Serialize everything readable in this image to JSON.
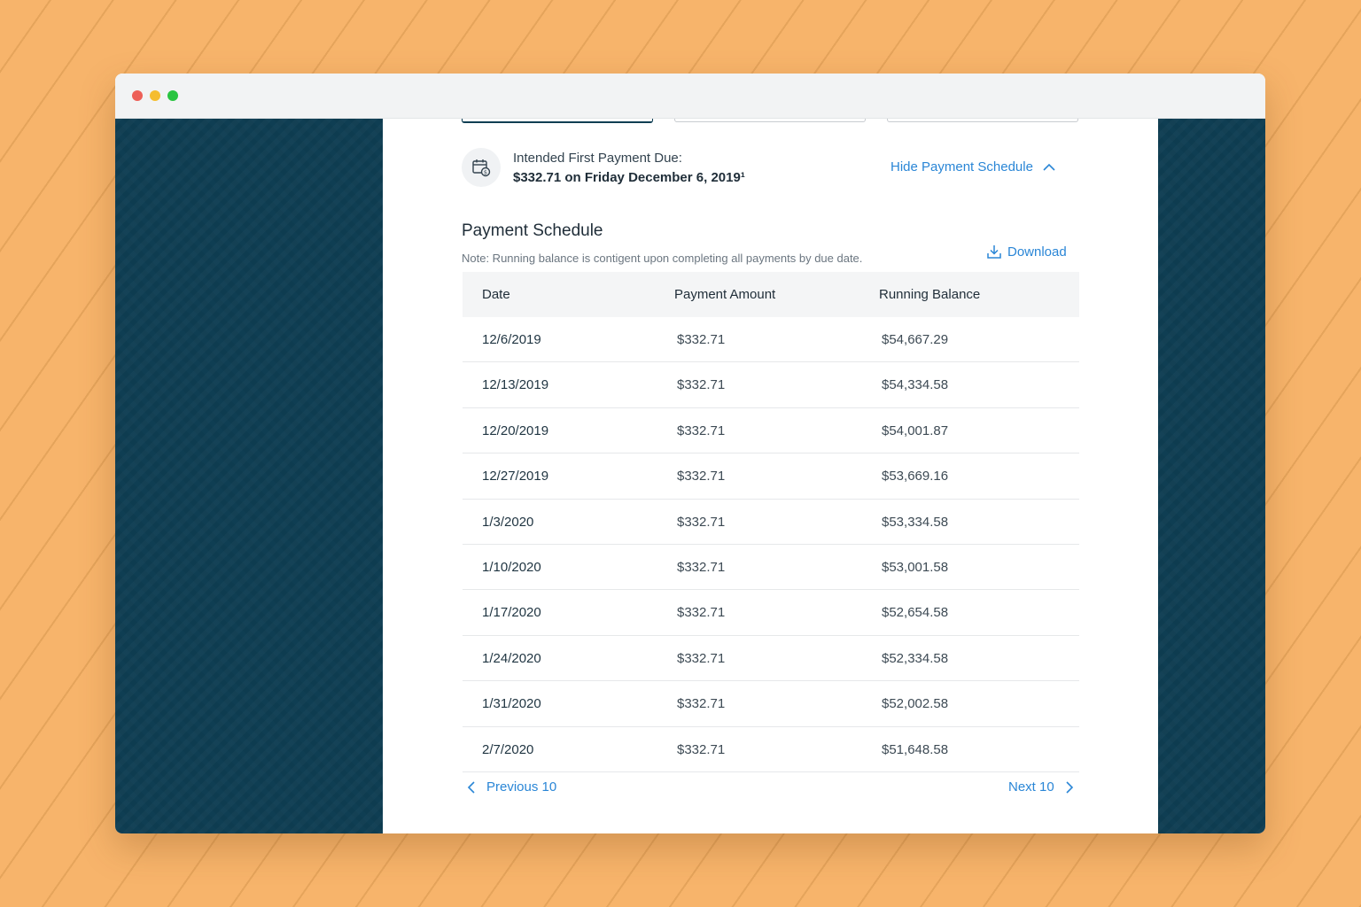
{
  "schedule": {
    "first_due_label": "Intended First Payment Due:",
    "first_due_value": "$332.71 on Friday December 6, 2019¹",
    "toggle_label": "Hide Payment Schedule",
    "title": "Payment Schedule",
    "note": "Note: Running balance is contigent upon completing all payments by due date.",
    "download_label": "Download",
    "columns": [
      "Date",
      "Payment Amount",
      "Running Balance"
    ],
    "rows": [
      {
        "date": "12/6/2019",
        "amount": "$332.71",
        "balance": "$54,667.29"
      },
      {
        "date": "12/13/2019",
        "amount": "$332.71",
        "balance": "$54,334.58"
      },
      {
        "date": "12/20/2019",
        "amount": "$332.71",
        "balance": "$54,001.87"
      },
      {
        "date": "12/27/2019",
        "amount": "$332.71",
        "balance": "$53,669.16"
      },
      {
        "date": "1/3/2020",
        "amount": "$332.71",
        "balance": "$53,334.58"
      },
      {
        "date": "1/10/2020",
        "amount": "$332.71",
        "balance": "$53,001.58"
      },
      {
        "date": "1/17/2020",
        "amount": "$332.71",
        "balance": "$52,654.58"
      },
      {
        "date": "1/24/2020",
        "amount": "$332.71",
        "balance": "$52,334.58"
      },
      {
        "date": "1/31/2020",
        "amount": "$332.71",
        "balance": "$52,002.58"
      },
      {
        "date": "2/7/2020",
        "amount": "$332.71",
        "balance": "$51,648.58"
      }
    ],
    "prev_label": "Previous 10",
    "next_label": "Next 10"
  },
  "icons": {
    "calendar": "calendar-dollar-icon",
    "toggle": "chevron-up-icon",
    "download": "download-icon",
    "prev": "chevron-left-icon",
    "next": "chevron-right-icon"
  },
  "colors": {
    "background": "#f7b46b",
    "sidebar": "#0f3e53",
    "link": "#2a86d6",
    "text": "#1f2d38"
  }
}
